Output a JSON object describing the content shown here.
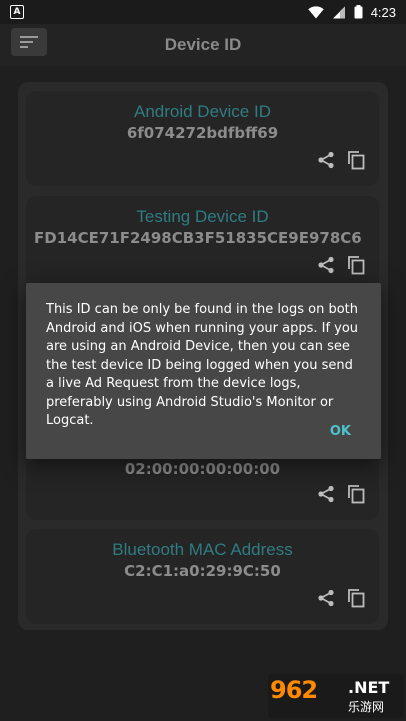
{
  "status_bar": {
    "notification_letter": "A",
    "time": "4:23"
  },
  "app_bar": {
    "title": "Device ID",
    "menu_icon": "menu-lines-icon"
  },
  "cards": [
    {
      "label": "Android Device ID",
      "value": "6f074272bdfbff69"
    },
    {
      "label": "Testing Device ID",
      "value": "FD14CE71F2498CB3F51835CE9E978C6"
    },
    {
      "label": "",
      "value": "02:00:00:00:00:00"
    },
    {
      "label": "Bluetooth MAC Address",
      "value": "C2:C1:a0:29:9C:50"
    }
  ],
  "dialog": {
    "message": "This ID can be only be found in the logs on both Android and iOS when running your apps. If you are using an Android Device, then you can see the test device ID being logged when you send a live Ad Request from the device logs, preferably using Android Studio's Monitor or Logcat.",
    "ok_label": "OK"
  },
  "watermark": {
    "number": "962",
    "net": ".NET",
    "cn": "乐游网"
  },
  "colors": {
    "background": "#1f1f1f",
    "label_teal": "#2f7c83",
    "ok_accent": "#4cc3cc",
    "dialog_bg": "#474747"
  }
}
